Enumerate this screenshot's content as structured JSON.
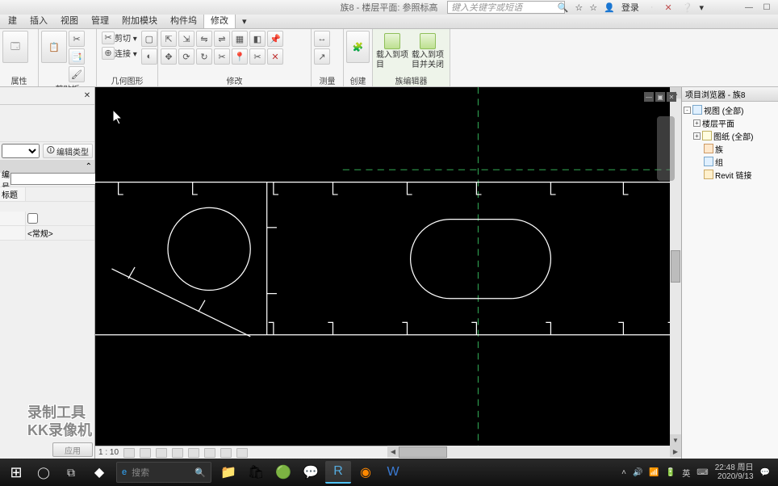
{
  "titlebar": {
    "doc_title": "族8 - 楼层平面: 参照标高",
    "search_placeholder": "键入关键字或短语",
    "login_label": "登录"
  },
  "menu": {
    "tabs": [
      "建",
      "插入",
      "视图",
      "管理",
      "附加模块",
      "构件坞",
      "修改"
    ],
    "active_index": 6,
    "overflow": "▾"
  },
  "ribbon": {
    "panels": {
      "properties": "属性",
      "clipboard": "剪贴板",
      "geometry": "几何图形",
      "modify": "修改",
      "measure": "测量",
      "create": "创建",
      "family_editor": "族编辑器"
    },
    "clipboard": {
      "cut": "剪切 ▾",
      "join": "连接 ▾"
    },
    "family_editor": {
      "load_project": "载入到项目",
      "load_close": "载入到项目并关闭"
    }
  },
  "props": {
    "edit_type": "编辑类型",
    "fields": {
      "number": {
        "label": "编号",
        "value": ""
      },
      "title": {
        "label": "标题",
        "value": ""
      }
    },
    "checkbox_row": {
      "value": false
    },
    "dropdown_row": {
      "value": "<常规>"
    },
    "apply": "应用"
  },
  "browser": {
    "title": "项目浏览器 - 族8",
    "nodes": [
      {
        "indent": 0,
        "toggle": "-",
        "icon": "view",
        "label": "视图 (全部)"
      },
      {
        "indent": 1,
        "toggle": "+",
        "icon": "",
        "label": "楼层平面"
      },
      {
        "indent": 1,
        "toggle": "+",
        "icon": "sheet",
        "label": "图纸 (全部)"
      },
      {
        "indent": 1,
        "toggle": "",
        "icon": "fam",
        "label": "族"
      },
      {
        "indent": 1,
        "toggle": "",
        "icon": "view",
        "label": "组"
      },
      {
        "indent": 1,
        "toggle": "",
        "icon": "link",
        "label": "Revit 链接"
      }
    ]
  },
  "status": {
    "scale": "1 : 10"
  },
  "taskbar": {
    "search_placeholder": "搜索",
    "tray_ime": "英",
    "clock": {
      "time": "22:48 周日",
      "date": "2020/9/13"
    }
  },
  "watermark": {
    "line1": "录制工具",
    "line2": "KK录像机"
  }
}
